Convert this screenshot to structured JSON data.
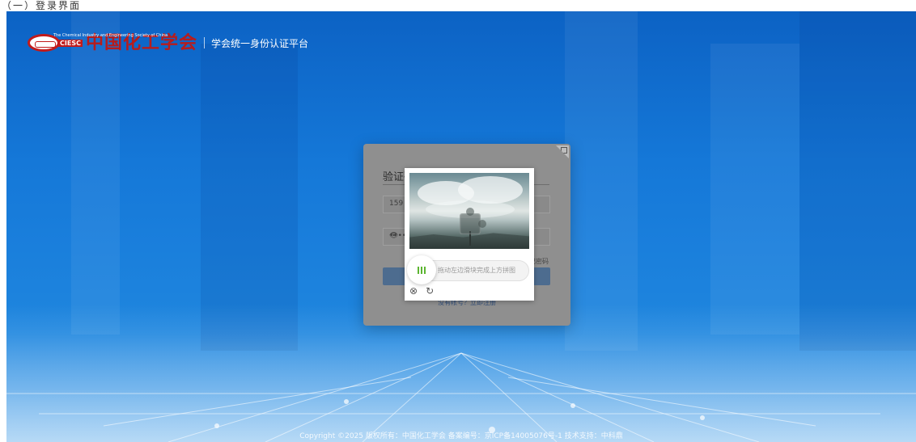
{
  "top_strip_text": "（⼀）登录界⾯",
  "header": {
    "logo_abbr": "CIESC",
    "org_name": "中国化工学会",
    "org_name_en": "The Chemical Industry and Engineering Society of China",
    "platform_name": "学会统一身份认证平台"
  },
  "login": {
    "title": "验证码",
    "phone_value": "159",
    "password_value": "••••",
    "remember_label": "记密码",
    "register_text": "没有帐号？立即注册"
  },
  "captcha": {
    "slider_hint": "拖动左边滑块完成上方拼图",
    "knob_icon": "grip-icon",
    "close_icon": "close-circle-icon",
    "refresh_icon": "refresh-icon",
    "accent_color": "#5cb531"
  },
  "footer": {
    "copyright": "Copyright ©2025 版权所有：中国化工学会 备案编号：京ICP备14005076号-1 技术支持：中科鼎"
  }
}
